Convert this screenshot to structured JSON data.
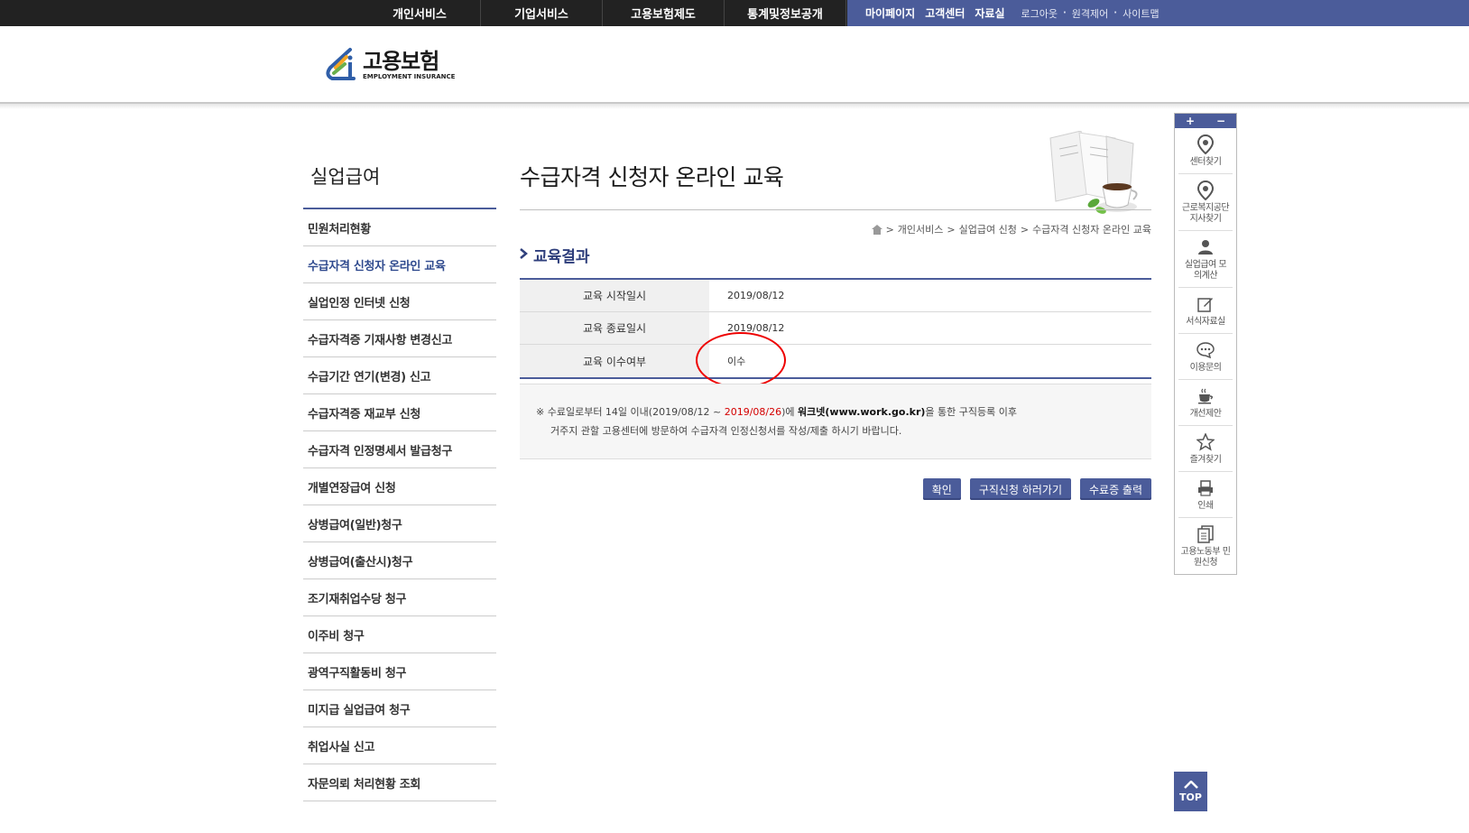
{
  "topnav": {
    "menus": [
      "개인서비스",
      "기업서비스",
      "고용보험제도",
      "통계및정보공개"
    ],
    "util_menus": [
      "마이페이지",
      "고객센터",
      "자료실"
    ],
    "small_links": [
      "로그아웃",
      "원격제어",
      "사이트맵"
    ]
  },
  "logo": {
    "ko": "고용보험",
    "en": "EMPLOYMENT INSURANCE"
  },
  "sidebar": {
    "title": "실업급여",
    "items": [
      "민원처리현황",
      "수급자격 신청자 온라인 교육",
      "실업인정 인터넷 신청",
      "수급자격증 기재사항 변경신고",
      "수급기간 연기(변경) 신고",
      "수급자격증 재교부 신청",
      "수급자격 인정명세서 발급청구",
      "개별연장급여 신청",
      "상병급여(일반)청구",
      "상병급여(출산시)청구",
      "조기재취업수당 청구",
      "이주비 청구",
      "광역구직활동비 청구",
      "미지급 실업급여 청구",
      "취업사실 신고",
      "자문의뢰 처리현황 조회"
    ],
    "active_index": 1
  },
  "main": {
    "page_title": "수급자격 신청자 온라인 교육",
    "breadcrumb": [
      "개인서비스",
      "실업급여 신청",
      "수급자격 신청자 온라인 교육"
    ],
    "section_title": "교육결과",
    "rows": [
      {
        "label": "교육 시작일시",
        "value": "2019/08/12"
      },
      {
        "label": "교육 종료일시",
        "value": "2019/08/12"
      },
      {
        "label": "교육 이수여부",
        "value": "이수"
      }
    ],
    "notice": {
      "mark": "※",
      "text1": "수료일로부터 14일 이내(2019/08/12 ~ ",
      "red_date": "2019/08/26",
      "text2": ")에 ",
      "site": "워크넷(www.work.go.kr)",
      "text3": "을 통한 구직등록 이후",
      "line2": "거주지 관할 고용센터에 방문하여 수급자격 인정신청서를 작성/제출 하시기 바랍니다."
    },
    "buttons": {
      "confirm": "확인",
      "job_apply": "구직신청 하러가기",
      "print_cert": "수료증 출력"
    }
  },
  "quick": {
    "plus": "+",
    "minus": "−",
    "items": [
      {
        "label": "센터찾기",
        "icon": "location-pin-icon"
      },
      {
        "label": "근로복지공단 지사찾기",
        "icon": "location-pin-icon"
      },
      {
        "label": "실업급여 모의계산",
        "icon": "person-icon"
      },
      {
        "label": "서식자료실",
        "icon": "edit-icon"
      },
      {
        "label": "이용문의",
        "icon": "chat-icon"
      },
      {
        "label": "개선제안",
        "icon": "coffee-icon"
      },
      {
        "label": "즐겨찾기",
        "icon": "star-icon"
      },
      {
        "label": "인쇄",
        "icon": "printer-icon"
      },
      {
        "label": "고용노동부 민원신청",
        "icon": "document-icon"
      }
    ],
    "top_label": "TOP"
  },
  "colors": {
    "accent": "#4b5c9a",
    "highlight_red": "#d40000",
    "active_text": "#2f4a8e"
  }
}
